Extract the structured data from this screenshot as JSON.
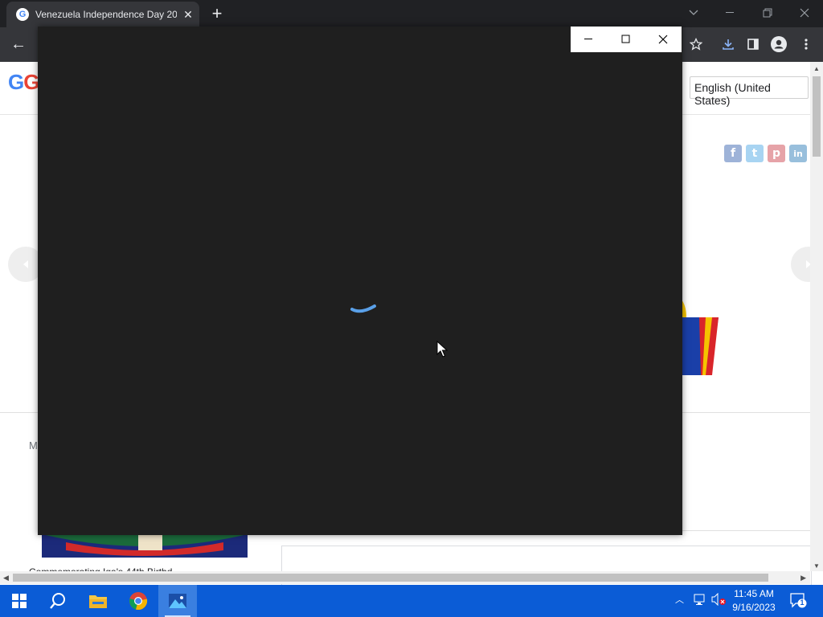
{
  "browser": {
    "tab_title": "Venezuela Independence Day 20",
    "tab_favicon": "G",
    "new_tab_symbol": "+",
    "tab_close_symbol": "✕",
    "back_symbol": "←"
  },
  "page": {
    "logo_text": "Go",
    "language_select_value": "English (United States)",
    "social_icons": [
      {
        "name": "facebook",
        "glyph": "f",
        "color": "#3b5998"
      },
      {
        "name": "twitter",
        "glyph": "t",
        "color": "#55acee"
      },
      {
        "name": "pinterest",
        "glyph": "p",
        "color": "#cb2027"
      },
      {
        "name": "linkedin",
        "glyph": "in",
        "color": "#0077b5"
      }
    ],
    "side_letter": "M",
    "card_caption": "Commemorating Iga's 44th Birthd"
  },
  "photos_app": {
    "minimize_symbol": "—",
    "maximize_symbol": "☐",
    "close_symbol": "✕",
    "loading": true
  },
  "taskbar": {
    "time": "11:45 AM",
    "date": "9/16/2023",
    "notification_count": "1"
  },
  "colors": {
    "browser_frame": "#202124",
    "toolbar": "#35363a",
    "photos_background": "#1f1f1f",
    "spinner": "#5aa0e8",
    "taskbar": "#0b5cd6"
  }
}
